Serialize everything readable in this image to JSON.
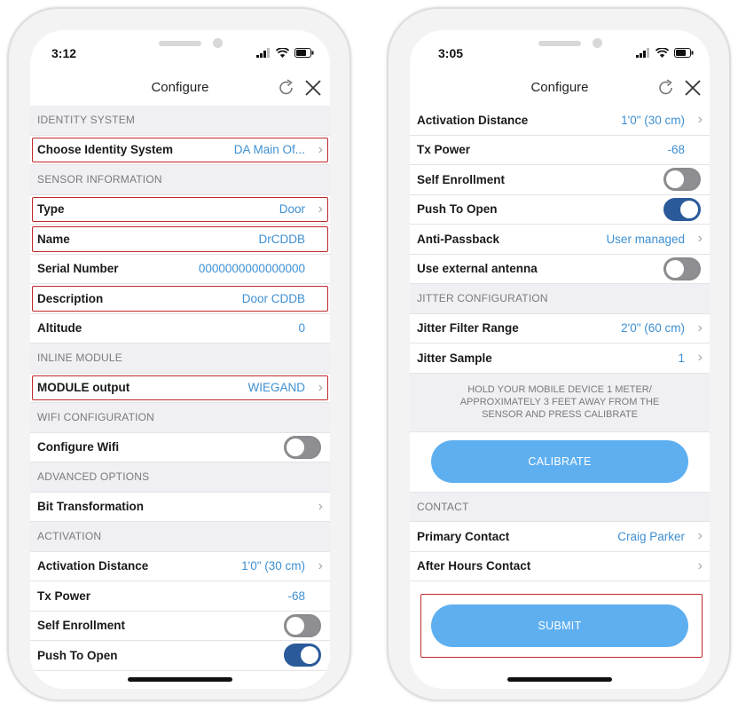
{
  "left": {
    "time": "3:12",
    "title": "Configure",
    "items": [
      {
        "kind": "section",
        "text": "IDENTITY SYSTEM"
      },
      {
        "kind": "row",
        "label": "Choose Identity System",
        "value": "DA Main Of...",
        "chevron": true,
        "highlight": true
      },
      {
        "kind": "section",
        "text": "SENSOR INFORMATION"
      },
      {
        "kind": "row",
        "label": "Type",
        "value": "Door",
        "chevron": true,
        "highlight": true
      },
      {
        "kind": "row",
        "label": "Name",
        "value": "DrCDDB",
        "chevron": false,
        "highlight": true
      },
      {
        "kind": "row",
        "label": "Serial Number",
        "value": "0000000000000000",
        "chevron": false
      },
      {
        "kind": "row",
        "label": "Description",
        "value": "Door CDDB",
        "chevron": false,
        "highlight": true
      },
      {
        "kind": "row",
        "label": "Altitude",
        "value": "0",
        "chevron": false
      },
      {
        "kind": "section",
        "text": "INLINE MODULE"
      },
      {
        "kind": "row",
        "label": "MODULE output",
        "value": "WIEGAND",
        "chevron": true,
        "highlight": true
      },
      {
        "kind": "section",
        "text": "WIFI CONFIGURATION"
      },
      {
        "kind": "toggle",
        "label": "Configure Wifi",
        "on": false
      },
      {
        "kind": "section",
        "text": "ADVANCED OPTIONS"
      },
      {
        "kind": "row",
        "label": "Bit Transformation",
        "value": "",
        "chevron": true
      },
      {
        "kind": "section",
        "text": "ACTIVATION"
      },
      {
        "kind": "row",
        "label": "Activation Distance",
        "value": "1'0\" (30 cm)",
        "chevron": true
      },
      {
        "kind": "row",
        "label": "Tx Power",
        "value": "-68",
        "chevron": false
      },
      {
        "kind": "toggle",
        "label": "Self Enrollment",
        "on": false
      },
      {
        "kind": "toggle",
        "label": "Push To Open",
        "on": true
      }
    ]
  },
  "right": {
    "time": "3:05",
    "title": "Configure",
    "items": [
      {
        "kind": "row",
        "label": "Activation Distance",
        "value": "1'0\" (30 cm)",
        "chevron": true
      },
      {
        "kind": "row",
        "label": "Tx Power",
        "value": "-68",
        "chevron": false
      },
      {
        "kind": "toggle",
        "label": "Self Enrollment",
        "on": false
      },
      {
        "kind": "toggle",
        "label": "Push To Open",
        "on": true
      },
      {
        "kind": "row",
        "label": "Anti-Passback",
        "value": "User managed",
        "chevron": true
      },
      {
        "kind": "toggle",
        "label": "Use external antenna",
        "on": false
      },
      {
        "kind": "section",
        "text": "JITTER CONFIGURATION"
      },
      {
        "kind": "row",
        "label": "Jitter Filter Range",
        "value": "2'0\" (60 cm)",
        "chevron": true
      },
      {
        "kind": "row",
        "label": "Jitter Sample",
        "value": "1",
        "chevron": true
      },
      {
        "kind": "instruction",
        "text": "HOLD YOUR MOBILE DEVICE 1 METER/ APPROXIMATELY 3 FEET AWAY FROM THE SENSOR AND PRESS CALIBRATE"
      },
      {
        "kind": "button",
        "label": "CALIBRATE"
      },
      {
        "kind": "section",
        "text": "CONTACT"
      },
      {
        "kind": "row",
        "label": "Primary Contact",
        "value": "Craig Parker",
        "chevron": true
      },
      {
        "kind": "row",
        "label": "After Hours Contact",
        "value": "",
        "chevron": true
      },
      {
        "kind": "submit",
        "label": "SUBMIT"
      }
    ]
  },
  "colors": {
    "accent": "#3e8fd1",
    "button": "#5eaff0",
    "highlight": "#c0282b",
    "toggle_on": "#2a5a9a"
  },
  "icons": {
    "refresh": "refresh-icon",
    "close": "close-icon",
    "chevron": "chevron-right-icon"
  }
}
